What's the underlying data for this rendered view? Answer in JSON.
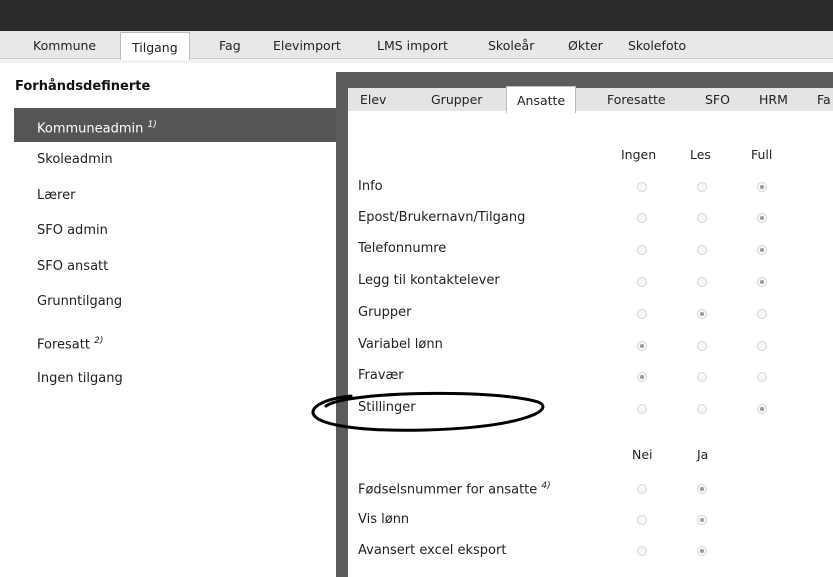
{
  "main_tabs": [
    {
      "label": "Kommune",
      "active": false
    },
    {
      "label": "Tilgang",
      "active": true
    },
    {
      "label": "Fag",
      "active": false
    },
    {
      "label": "Elevimport",
      "active": false
    },
    {
      "label": "LMS import",
      "active": false
    },
    {
      "label": "Skoleår",
      "active": false
    },
    {
      "label": "Økter",
      "active": false
    },
    {
      "label": "Skolefoto",
      "active": false
    }
  ],
  "sidebar": {
    "title": "Forhåndsdefinerte",
    "items": [
      {
        "label": "Kommuneadmin",
        "note": "1)",
        "active": true
      },
      {
        "label": "Skoleadmin",
        "note": "",
        "active": false
      },
      {
        "label": "Lærer",
        "note": "",
        "active": false
      },
      {
        "label": "SFO admin",
        "note": "",
        "active": false
      },
      {
        "label": "SFO ansatt",
        "note": "",
        "active": false
      },
      {
        "label": "Grunntilgang",
        "note": "",
        "active": false
      },
      {
        "label": "Foresatt",
        "note": "2)",
        "active": false
      },
      {
        "label": "Ingen tilgang",
        "note": "",
        "active": false
      }
    ]
  },
  "sub_tabs": [
    {
      "label": "Elev",
      "active": false
    },
    {
      "label": "Grupper",
      "active": false
    },
    {
      "label": "Ansatte",
      "active": true
    },
    {
      "label": "Foresatte",
      "active": false
    },
    {
      "label": "SFO",
      "active": false
    },
    {
      "label": "HRM",
      "active": false
    },
    {
      "label": "Fa",
      "active": false
    }
  ],
  "access_table": {
    "columns": [
      "Ingen",
      "Les",
      "Full"
    ],
    "rows": [
      {
        "label": "Info",
        "selected": 2
      },
      {
        "label": "Epost/Brukernavn/Tilgang",
        "selected": 2
      },
      {
        "label": "Telefonnumre",
        "selected": 2
      },
      {
        "label": "Legg til kontaktelever",
        "selected": 2
      },
      {
        "label": "Grupper",
        "selected": 1
      },
      {
        "label": "Variabel lønn",
        "selected": 0
      },
      {
        "label": "Fravær",
        "selected": 0
      },
      {
        "label": "Stillinger",
        "selected": 2
      }
    ]
  },
  "yesno_table": {
    "columns": [
      "Nei",
      "Ja"
    ],
    "rows": [
      {
        "label": "Fødselsnummer for ansatte",
        "note": "4)",
        "selected": 1
      },
      {
        "label": "Vis lønn",
        "note": "",
        "selected": 1
      },
      {
        "label": "Avansert excel eksport",
        "note": "",
        "selected": 1
      }
    ]
  },
  "annotation": {
    "shape": "hand-drawn-ellipse",
    "color": "#000000",
    "target": "Stillinger"
  }
}
